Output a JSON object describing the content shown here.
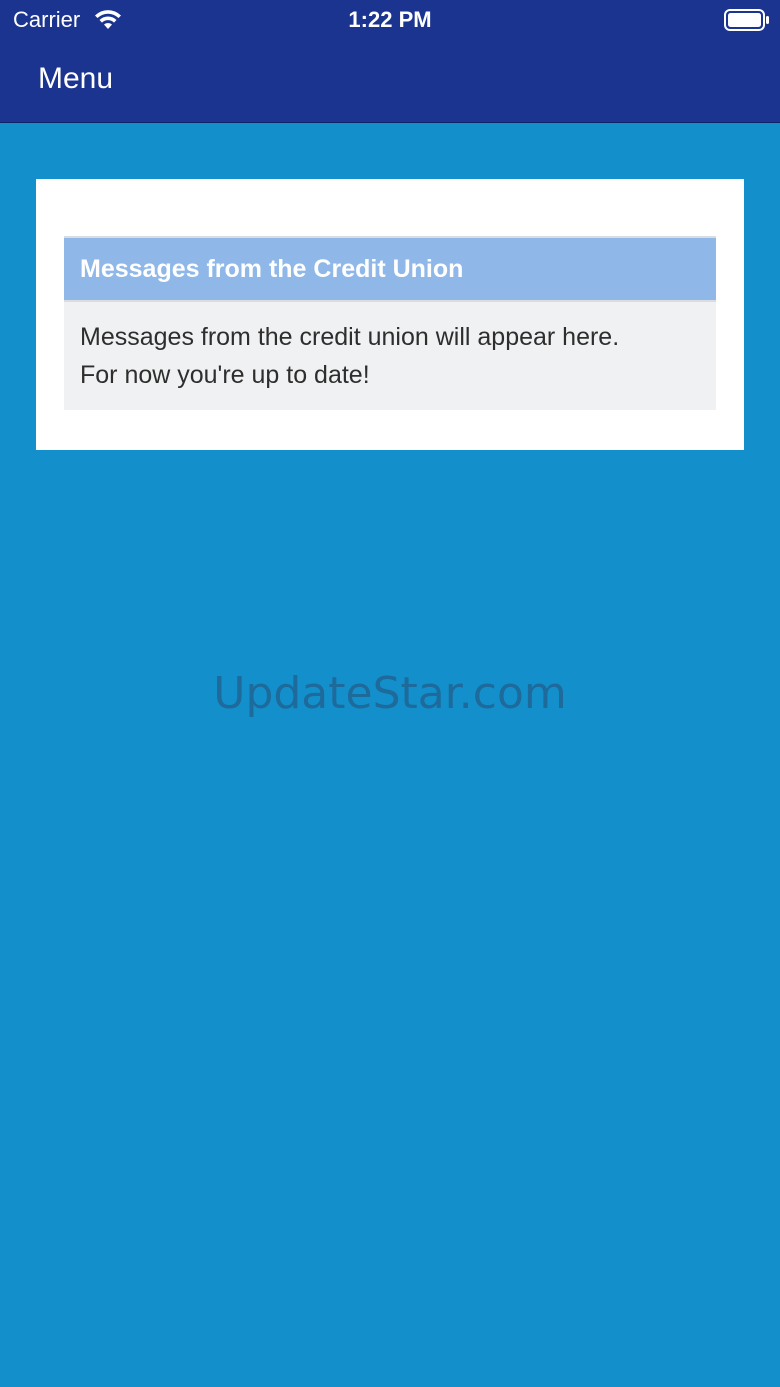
{
  "status_bar": {
    "carrier": "Carrier",
    "time": "1:22 PM",
    "wifi_icon": "wifi-icon",
    "battery_icon": "battery-full-icon"
  },
  "nav": {
    "menu_label": "Menu"
  },
  "messages_panel": {
    "title": "Messages from the Credit Union",
    "body_line1": "Messages from the credit union will appear here.",
    "body_line2": "For now you're up to date!"
  },
  "watermark": "UpdateStar.com",
  "colors": {
    "background": "#1390cb",
    "top_bar": "#1b3490",
    "panel_header": "#8fb8e9",
    "panel_body": "#f0f1f2"
  }
}
